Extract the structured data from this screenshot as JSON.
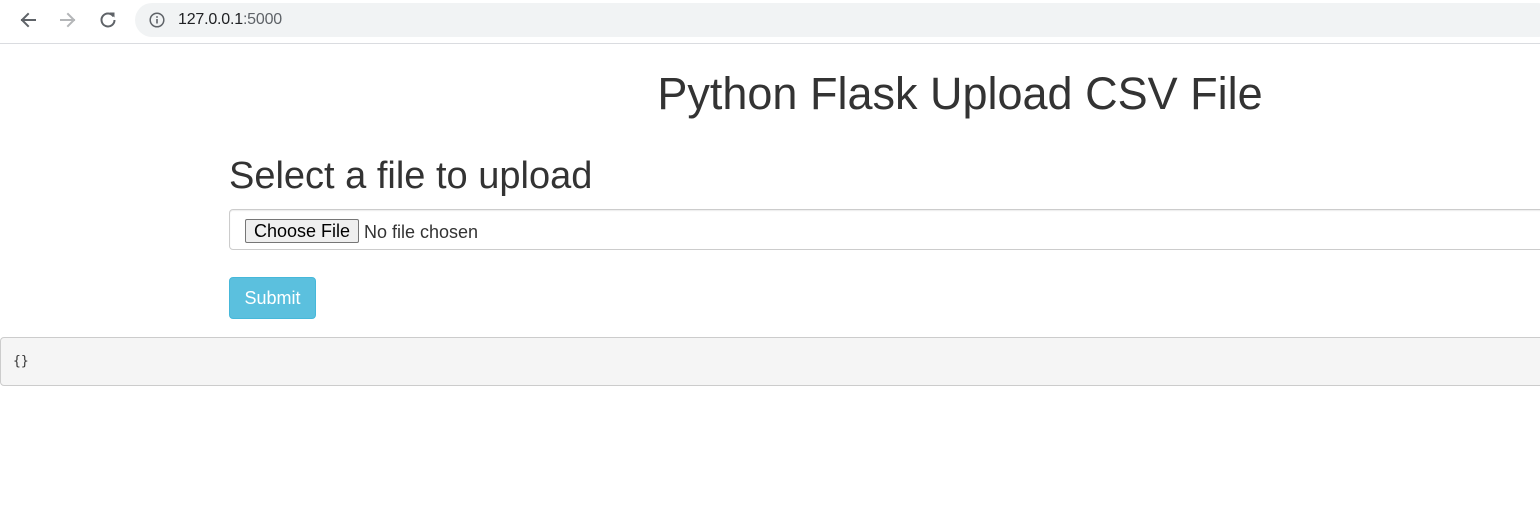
{
  "browser": {
    "url_host": "127.0.0.1",
    "url_port": ":5000",
    "icons": {
      "back": "arrow-left-icon",
      "forward": "arrow-right-icon",
      "reload": "reload-icon",
      "site_info": "info-icon"
    }
  },
  "page": {
    "title": "Python Flask Upload CSV File",
    "section_heading": "Select a file to upload",
    "file_input": {
      "button_label": "Choose File",
      "status_text": "No file chosen"
    },
    "submit_label": "Submit",
    "output_text": "{}"
  },
  "colors": {
    "submit_background": "#5bc0de",
    "submit_text": "#ffffff",
    "text": "#333333",
    "output_background": "#f5f5f5"
  }
}
